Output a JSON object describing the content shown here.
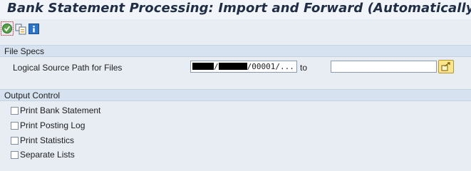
{
  "window": {
    "title": "Bank Statement Processing: Import and Forward (Automatically)"
  },
  "toolbar": {
    "icons": [
      "execute-icon",
      "get-variant-icon",
      "info-icon"
    ]
  },
  "file_specs": {
    "header": "File Specs",
    "logical_path_label": "Logical Source Path for Files",
    "from_value_segments": [
      "/",
      "/00001/..."
    ],
    "to_label": "to",
    "to_value": ""
  },
  "output_control": {
    "header": "Output Control",
    "options": [
      {
        "label": "Print Bank Statement",
        "checked": false
      },
      {
        "label": "Print Posting Log",
        "checked": false
      },
      {
        "label": "Print Statistics",
        "checked": false
      },
      {
        "label": "Separate Lists",
        "checked": false
      }
    ]
  }
}
